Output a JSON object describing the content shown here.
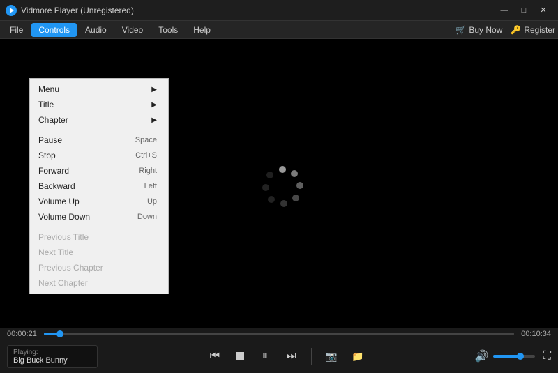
{
  "app": {
    "title": "Vidmore Player (Unregistered)",
    "logo_symbol": "▶"
  },
  "window_controls": {
    "minimize": "—",
    "maximize": "□",
    "close": "✕"
  },
  "menu_bar": {
    "left": [
      {
        "id": "file",
        "label": "File"
      },
      {
        "id": "controls",
        "label": "Controls",
        "active": true
      },
      {
        "id": "audio",
        "label": "Audio"
      },
      {
        "id": "video",
        "label": "Video"
      },
      {
        "id": "tools",
        "label": "Tools"
      },
      {
        "id": "help",
        "label": "Help"
      }
    ],
    "right": [
      {
        "id": "buy-now",
        "label": "Buy Now",
        "icon": "🛒"
      },
      {
        "id": "register",
        "label": "Register",
        "icon": "🔑"
      }
    ]
  },
  "controls_dropdown": {
    "items": [
      {
        "id": "menu",
        "label": "Menu",
        "shortcut": "",
        "has_arrow": true,
        "disabled": false
      },
      {
        "id": "title",
        "label": "Title",
        "shortcut": "",
        "has_arrow": true,
        "disabled": false
      },
      {
        "id": "chapter",
        "label": "Chapter",
        "shortcut": "",
        "has_arrow": true,
        "disabled": false
      },
      {
        "id": "separator1",
        "type": "separator"
      },
      {
        "id": "pause",
        "label": "Pause",
        "shortcut": "Space",
        "has_arrow": false,
        "disabled": false
      },
      {
        "id": "stop",
        "label": "Stop",
        "shortcut": "Ctrl+S",
        "has_arrow": false,
        "disabled": false
      },
      {
        "id": "forward",
        "label": "Forward",
        "shortcut": "Right",
        "has_arrow": false,
        "disabled": false
      },
      {
        "id": "backward",
        "label": "Backward",
        "shortcut": "Left",
        "has_arrow": false,
        "disabled": false
      },
      {
        "id": "volume-up",
        "label": "Volume Up",
        "shortcut": "Up",
        "has_arrow": false,
        "disabled": false
      },
      {
        "id": "volume-down",
        "label": "Volume Down",
        "shortcut": "Down",
        "has_arrow": false,
        "disabled": false
      },
      {
        "id": "separator2",
        "type": "separator"
      },
      {
        "id": "previous-title",
        "label": "Previous Title",
        "shortcut": "",
        "has_arrow": false,
        "disabled": true
      },
      {
        "id": "next-title",
        "label": "Next Title",
        "shortcut": "",
        "has_arrow": false,
        "disabled": true
      },
      {
        "id": "previous-chapter",
        "label": "Previous Chapter",
        "shortcut": "",
        "has_arrow": false,
        "disabled": true
      },
      {
        "id": "next-chapter",
        "label": "Next Chapter",
        "shortcut": "",
        "has_arrow": false,
        "disabled": true
      }
    ]
  },
  "progress": {
    "current_time": "00:00:21",
    "total_time": "00:10:34",
    "percent": 3.37
  },
  "controls": {
    "rewind": "⏮",
    "stop": "■",
    "pause": "⏸",
    "forward": "⏭"
  },
  "playing": {
    "label": "Playing:",
    "title": "Big Buck Bunny"
  },
  "volume": {
    "percent": 65
  }
}
